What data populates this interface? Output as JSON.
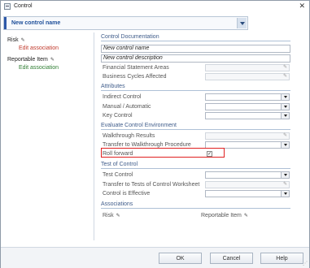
{
  "window": {
    "title": "Control",
    "close_label": "✕"
  },
  "name_bar": {
    "value": "New control name"
  },
  "sidebar": {
    "items": [
      {
        "label": "Risk",
        "link": "Edit association",
        "link_color": "#c0392b"
      },
      {
        "label": "Reportable Item",
        "link": "Edit association",
        "link_color": "#2e7d32"
      }
    ]
  },
  "sections": {
    "documentation": "Control Documentation",
    "attributes": "Attributes",
    "evaluate": "Evaluate Control Environment",
    "test": "Test of Control",
    "associations": "Associations"
  },
  "documentation": {
    "name": "New control name",
    "description": "New control description",
    "fs_areas": "Financial Statement Areas",
    "business_cycles": "Business Cycles Affected"
  },
  "attributes": {
    "indirect": "Indirect Control",
    "manual_auto": "Manual / Automatic",
    "key": "Key Control"
  },
  "evaluate": {
    "walkthrough_results": "Walkthrough Results",
    "transfer_walkthrough": "Transfer to Walkthrough Procedure",
    "roll_forward": "Roll forward",
    "roll_forward_checked": "✓"
  },
  "test": {
    "test_control": "Test Control",
    "transfer_worksheet": "Transfer to Tests of Control Worksheet",
    "is_effective": "Control is Effective"
  },
  "associations": {
    "risk": "Risk",
    "reportable": "Reportable Item"
  },
  "footer": {
    "ok": "OK",
    "cancel": "Cancel",
    "help": "Help"
  },
  "colors": {
    "accent": "#2e58a8",
    "highlight": "#e02020",
    "section_text": "#3f5c8a"
  }
}
